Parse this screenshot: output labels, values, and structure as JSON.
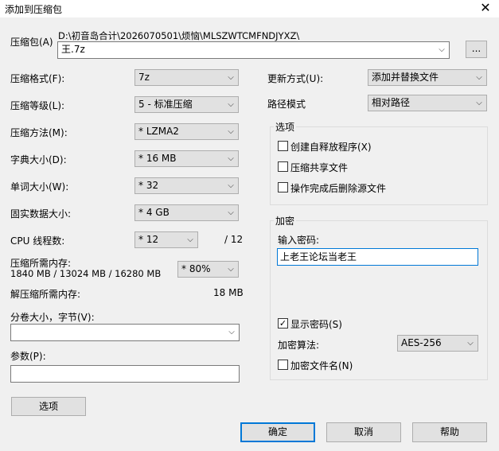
{
  "window": {
    "title": "添加到压缩包",
    "close_glyph": "✕"
  },
  "archive": {
    "label": "压缩包(A)",
    "path": "D:\\初音岛合计\\2026070501\\烦恼\\MLSZWTCMFNDJYXZ\\",
    "name": "王.7z",
    "browse_label": "..."
  },
  "left": {
    "format": {
      "label": "压缩格式(F):",
      "value": "7z"
    },
    "level": {
      "label": "压缩等级(L):",
      "value": "5 - 标准压缩"
    },
    "method": {
      "label": "压缩方法(M):",
      "value": "* LZMA2"
    },
    "dict": {
      "label": "字典大小(D):",
      "value": "* 16 MB"
    },
    "word": {
      "label": "单词大小(W):",
      "value": "* 32"
    },
    "solid": {
      "label": "固实数据大小:",
      "value": "* 4 GB"
    },
    "cpu": {
      "label": "CPU 线程数:",
      "value": "* 12",
      "max": "/ 12"
    },
    "mem_compress": {
      "label": "压缩所需内存:",
      "detail": "1840 MB / 13024 MB / 16280 MB",
      "value": "* 80%"
    },
    "mem_decompress": {
      "label": "解压缩所需内存:",
      "value": "18 MB"
    },
    "volume": {
      "label": "分卷大小，字节(V):",
      "value": ""
    },
    "params": {
      "label": "参数(P):",
      "value": ""
    },
    "options_button": "选项"
  },
  "right": {
    "update": {
      "label": "更新方式(U):",
      "value": "添加并替换文件"
    },
    "pathmode": {
      "label": "路径模式",
      "value": "相对路径"
    },
    "options_group": {
      "title": "选项",
      "sfx": "创建自释放程序(X)",
      "shared": "压缩共享文件",
      "delete_after": "操作完成后删除源文件"
    },
    "encrypt_group": {
      "title": "加密",
      "password_label": "输入密码:",
      "password_value": "上老王论坛当老王",
      "show_password": "显示密码(S)",
      "method_label": "加密算法:",
      "method_value": "AES-256",
      "encrypt_names": "加密文件名(N)"
    }
  },
  "checks": {
    "sfx": false,
    "shared": false,
    "delete_after": false,
    "show_password": true,
    "encrypt_names": false,
    "check_glyph": "✓"
  },
  "buttons": {
    "ok": "确定",
    "cancel": "取消",
    "help": "帮助"
  },
  "icons": {
    "dropdown": "chevron-down-icon",
    "dropdown_glyph": "⌵"
  },
  "colors": {
    "accent": "#0078d7",
    "window_bg": "#f0f0f0"
  }
}
